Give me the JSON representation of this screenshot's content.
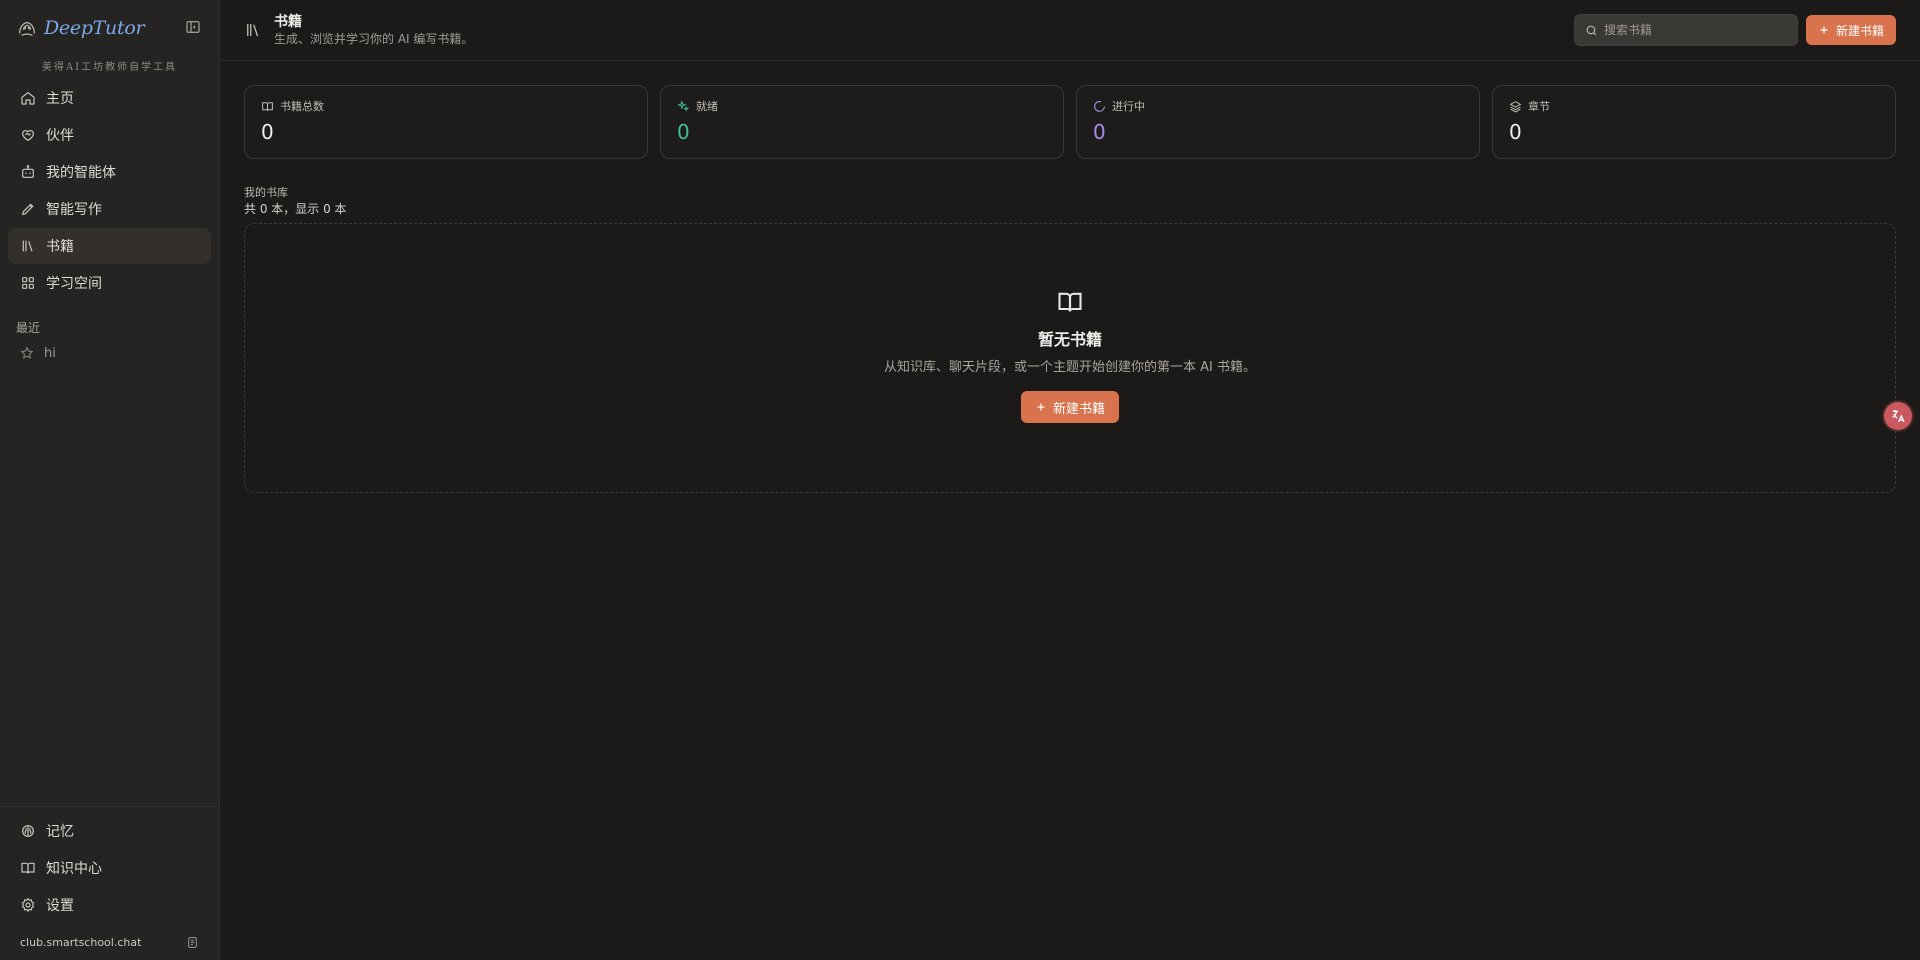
{
  "sidebar": {
    "brand": "DeepTutor",
    "tagline": "美得AI工坊教师自学工具",
    "nav": [
      {
        "label": "主页",
        "icon": "home-icon"
      },
      {
        "label": "伙伴",
        "icon": "heart-handshake-icon"
      },
      {
        "label": "我的智能体",
        "icon": "bot-icon"
      },
      {
        "label": "智能写作",
        "icon": "pen-icon"
      },
      {
        "label": "书籍",
        "icon": "library-icon",
        "active": true
      },
      {
        "label": "学习空间",
        "icon": "grid-icon"
      }
    ],
    "recent_label": "最近",
    "recent": [
      {
        "label": "hi",
        "icon": "star-icon"
      }
    ],
    "bottom_nav": [
      {
        "label": "记忆",
        "icon": "brain-icon"
      },
      {
        "label": "知识中心",
        "icon": "book-open-icon"
      },
      {
        "label": "设置",
        "icon": "settings-icon"
      }
    ],
    "footer_domain": "club.smartschool.chat"
  },
  "header": {
    "title": "书籍",
    "subtitle": "生成、浏览并学习你的 AI 编写书籍。",
    "search_placeholder": "搜索书籍",
    "new_book_label": "新建书籍"
  },
  "stats": [
    {
      "label": "书籍总数",
      "value": "0",
      "icon": "book-icon",
      "color": "#f0ede9"
    },
    {
      "label": "就绪",
      "value": "0",
      "icon": "sparkles-icon",
      "color": "#3fbf8f"
    },
    {
      "label": "进行中",
      "value": "0",
      "icon": "loader-icon",
      "color": "#a58ae8"
    },
    {
      "label": "章节",
      "value": "0",
      "icon": "layers-icon",
      "color": "#f0ede9"
    }
  ],
  "library": {
    "title": "我的书库",
    "count_text": "共 0 本，显示 0 本"
  },
  "empty_state": {
    "title": "暂无书籍",
    "description": "从知识库、聊天片段，或一个主题开始创建你的第一本 AI 书籍。",
    "button_label": "新建书籍"
  },
  "colors": {
    "accent": "#d8734e",
    "background": "#1b1a19",
    "sidebar": "#252422"
  }
}
